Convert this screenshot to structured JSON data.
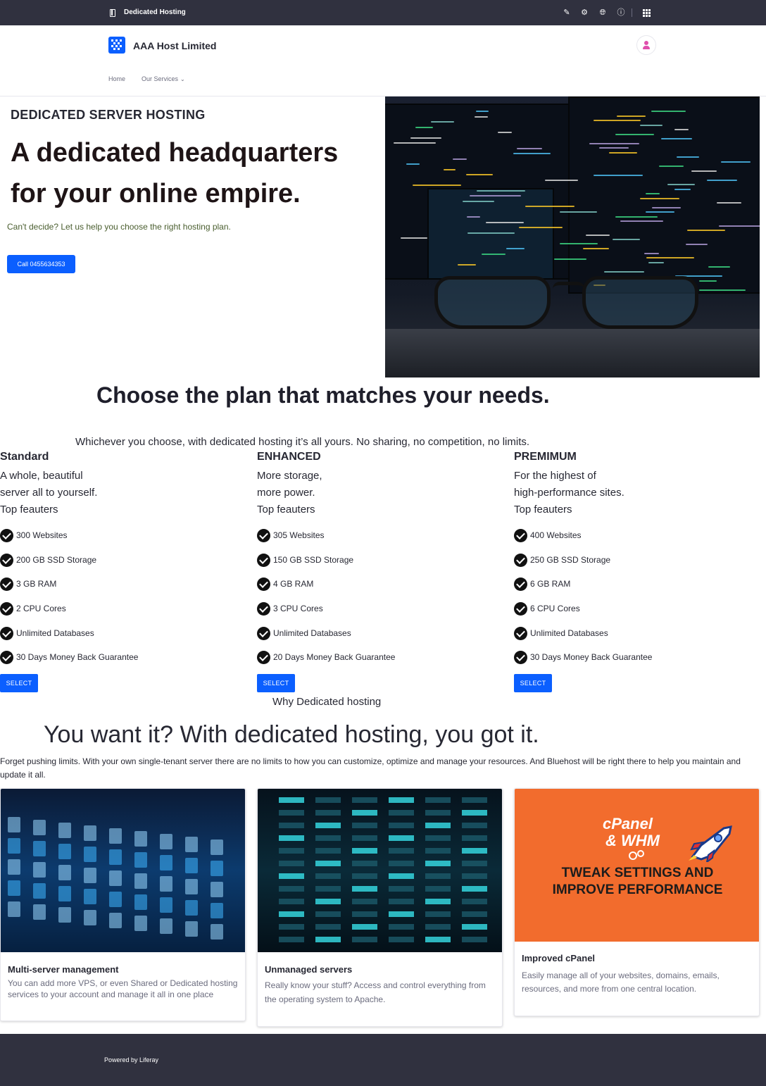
{
  "topbar": {
    "page_title": "Dedicated Hosting",
    "tools": [
      "edit-icon",
      "gear-icon",
      "globe-icon",
      "info-icon",
      "apps-icon"
    ]
  },
  "header": {
    "site_name": "AAA Host Limited",
    "nav": {
      "home": "Home",
      "services": "Our Services"
    }
  },
  "hero": {
    "eyebrow": "DEDICATED SERVER HOSTING",
    "headline": "A dedicated headquarters for your online empire.",
    "subline": "Can't decide? Let us help you choose the right hosting plan.",
    "call_button": "Call 0455634353"
  },
  "plans": {
    "title": "Choose the plan that matches your needs.",
    "subtitle": "Whichever you choose, with dedicated hosting it’s all yours. No sharing, no competition, no limits.",
    "items": [
      {
        "name": "Standard",
        "desc": [
          "A whole, beautiful",
          "server all to yourself."
        ],
        "features_label": "Top feauters",
        "features": [
          "300 Websites",
          "200 GB SSD Storage",
          "3 GB RAM",
          "2 CPU Cores",
          "Unlimited Databases",
          "30 Days Money Back Guarantee"
        ],
        "button": "SELECT"
      },
      {
        "name": "ENHANCED",
        "desc": [
          "More storage,",
          "more power."
        ],
        "features_label": "Top feauters",
        "features": [
          "305 Websites",
          "150 GB SSD Storage",
          "4 GB RAM",
          "3 CPU Cores",
          "Unlimited Databases",
          "20 Days Money Back Guarantee"
        ],
        "button": "SELECT"
      },
      {
        "name": "PREMIMUM",
        "desc": [
          "For the highest of",
          "high-performance sites."
        ],
        "features_label": "Top feauters",
        "features": [
          "400 Websites",
          "250 GB SSD Storage",
          "6 GB RAM",
          "6 CPU Cores",
          "Unlimited Databases",
          "30 Days Money Back Guarantee"
        ],
        "button": "SELECT"
      }
    ]
  },
  "why": {
    "label": "Why Dedicated hosting",
    "title": "You want it? With dedicated hosting, you got it.",
    "text": "Forget pushing limits. With your own single-tenant server there are no limits to how you can customize, optimize and manage your resources. And Bluehost will be right there to help you maintain and update it all."
  },
  "cards": [
    {
      "title": "Multi-server management",
      "text": "You can add more VPS, or even Shared or Dedicated hosting services to your account and manage it all in one place"
    },
    {
      "title": "Unmanaged servers",
      "text": "Really know your stuff? Access and control everything from the operating system to Apache."
    },
    {
      "title": "Improved cPanel",
      "text": "Easily manage all of your websites, domains, emails, resources, and more from one central location.",
      "image_text": {
        "logo_line1": "cPanel",
        "logo_line2": "& WHM",
        "head_line1": "TWEAK SETTINGS AND",
        "head_line2": "IMPROVE PERFORMANCE"
      }
    }
  ],
  "footer": {
    "powered": "Powered by Liferay"
  },
  "colors": {
    "accent": "#0b5fff",
    "bar": "#30313f",
    "cpanel_orange": "#f26c2d"
  }
}
